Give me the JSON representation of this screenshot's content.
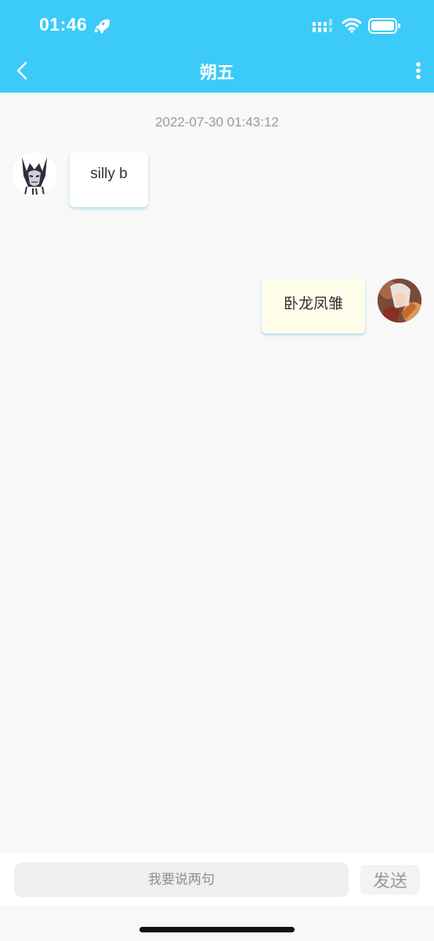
{
  "status_bar": {
    "time": "01:46"
  },
  "nav": {
    "title": "朔五"
  },
  "chat": {
    "timestamp": "2022-07-30 01:43:12",
    "messages": [
      {
        "side": "left",
        "text": "silly b"
      },
      {
        "side": "right",
        "text": "卧龙凤雏"
      }
    ]
  },
  "composer": {
    "placeholder": "我要说两句",
    "send_label": "发送"
  },
  "colors": {
    "header_bg": "#3ccbf9",
    "page_bg": "#f8f8f8",
    "right_bubble_bg": "#fdfdea"
  },
  "icons": {
    "back": "chevron-left-icon",
    "more": "more-vertical-icon",
    "status": [
      "rocket-icon",
      "signal-icon",
      "wifi-icon",
      "battery-icon"
    ]
  }
}
